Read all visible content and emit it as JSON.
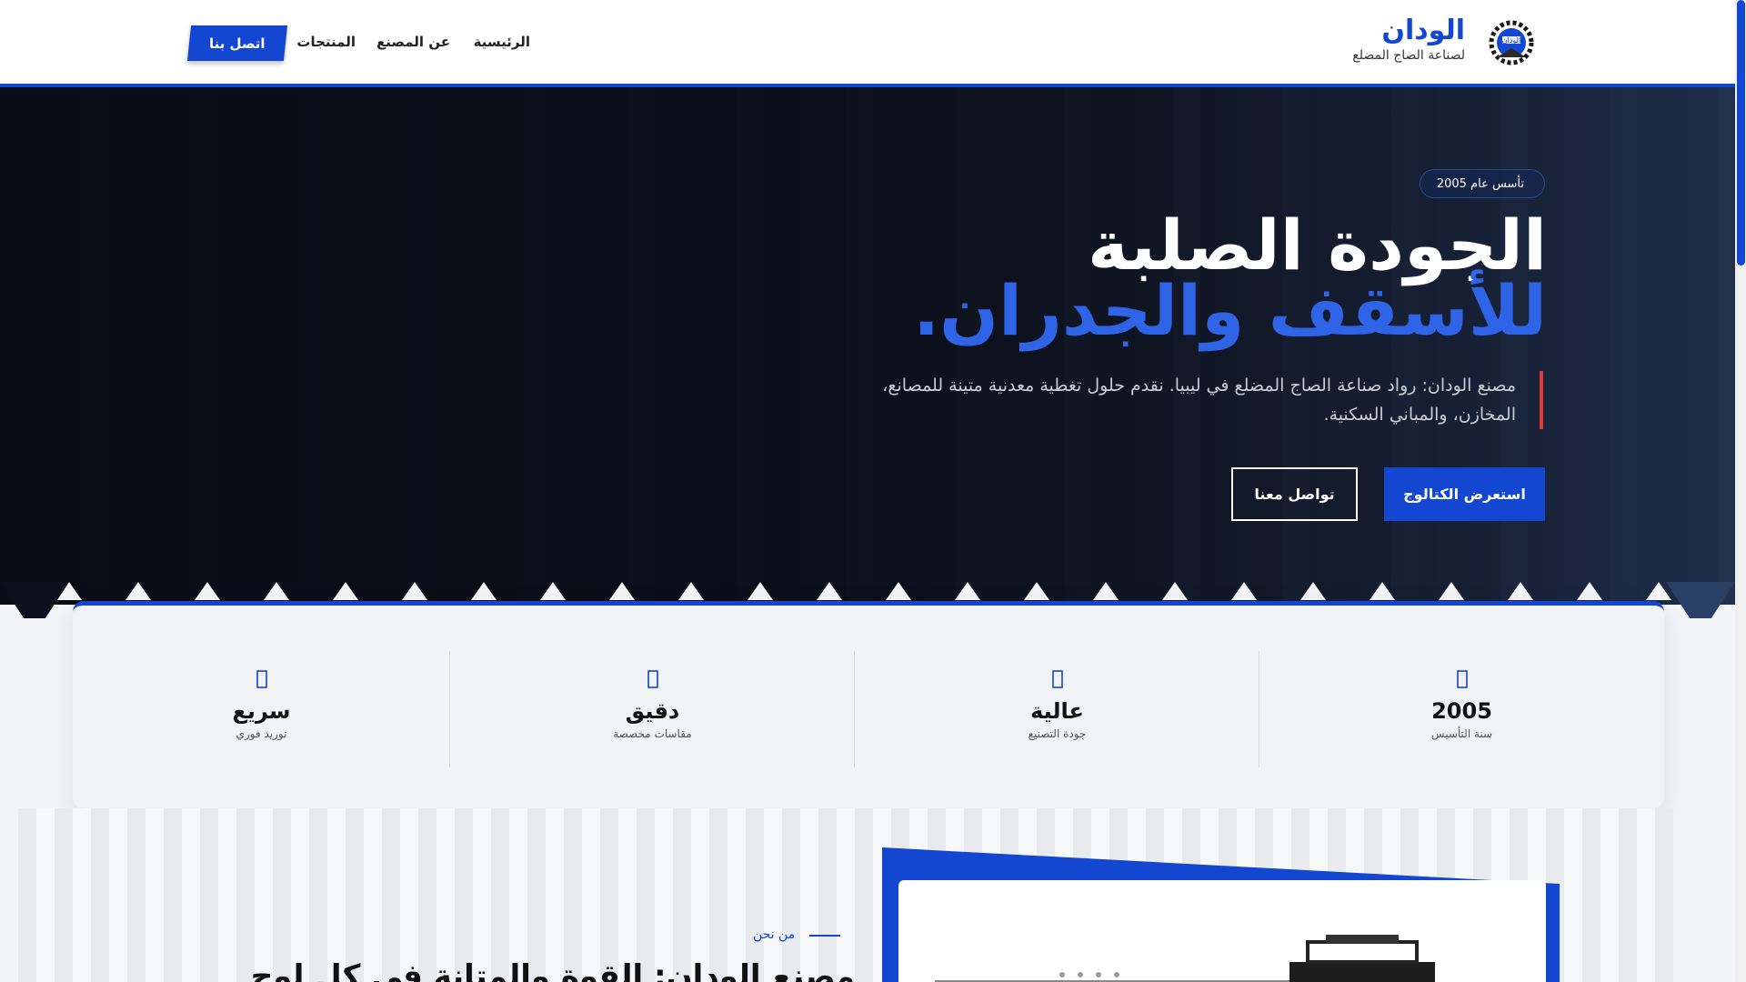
{
  "header": {
    "brand_name": "الودان",
    "brand_tagline": "لصناعة الصاج المضلع",
    "logo_text": "الودان",
    "nav": {
      "home": "الرئيسية",
      "about": "عن المصنع",
      "products": "المنتجات"
    },
    "contact_button": "اتصل بنا"
  },
  "hero": {
    "badge": "تأسس عام 2005",
    "title_line1": "الجودة الصلبة",
    "title_line2": "للأسقف والجدران.",
    "description": "مصنع الودان: رواد صناعة الصاج المضلع في ليبيا. نقدم حلول تغطية معدنية متينة للمصانع، المخازن، والمباني السكنية.",
    "primary_button": "استعرض الكتالوج",
    "secondary_button": "تواصل معنا"
  },
  "stats": [
    {
      "value": "2005",
      "label": "سنة التأسيس",
      "icon": "calendar-icon"
    },
    {
      "value": "عالية",
      "label": "جودة التصنيع",
      "icon": "award-icon"
    },
    {
      "value": "دقيق",
      "label": "مقاسات مخصصة",
      "icon": "ruler-icon"
    },
    {
      "value": "سريع",
      "label": "توريد فوري",
      "icon": "truck-icon"
    }
  ],
  "about": {
    "kicker": "من نحن",
    "title": "مصنع الودان: القوة والمتانة في كل لوح"
  },
  "colors": {
    "brand_blue": "#1447d1",
    "accent_red": "#e03a3e",
    "hero_dark": "#0b0f1a"
  }
}
